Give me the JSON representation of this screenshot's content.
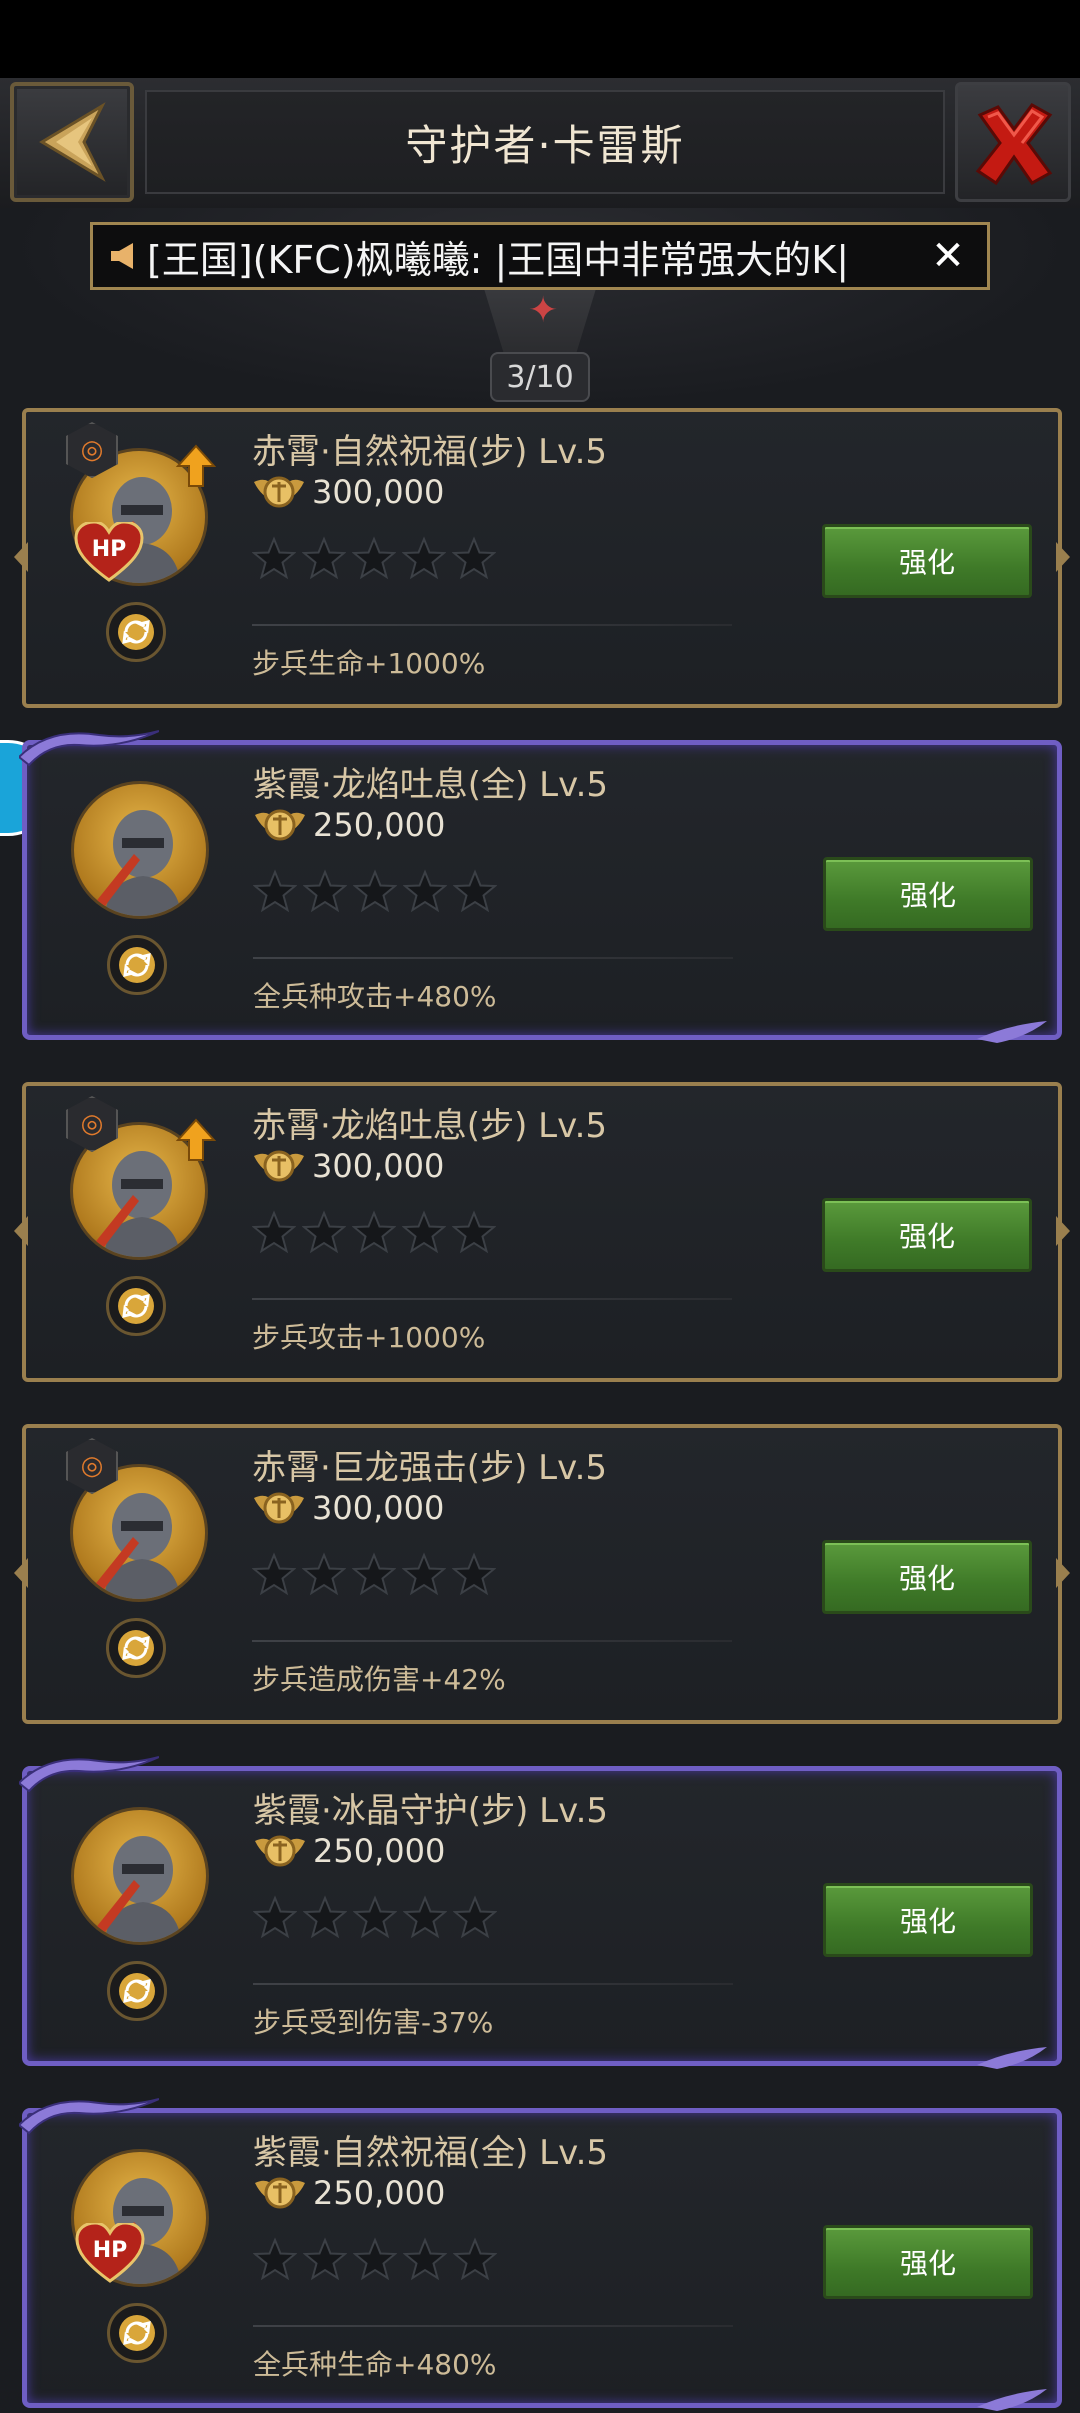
{
  "header": {
    "title": "守护者·卡雷斯"
  },
  "announcement": {
    "text": "[王国](KFC)枫曦曦: |王国中非常强大的K|",
    "close": "✕"
  },
  "progress": {
    "text": "3/10",
    "current": 3,
    "total": 10
  },
  "colors": {
    "gold_border": "#9a7f4e",
    "purple_border": "#6f5ec4",
    "button_green": "#4a8a32",
    "text_tan": "#d8c7a6"
  },
  "cards": [
    {
      "title": "赤霄·自然祝福(步) Lv.5",
      "cost": "300,000",
      "effect": "步兵生命+1000%",
      "button": "强化",
      "frame": "gold",
      "stars": 0
    },
    {
      "title": "紫霞·龙焰吐息(全) Lv.5",
      "cost": "250,000",
      "effect": "全兵种攻击+480%",
      "button": "强化",
      "frame": "purple",
      "stars": 0
    },
    {
      "title": "赤霄·龙焰吐息(步) Lv.5",
      "cost": "300,000",
      "effect": "步兵攻击+1000%",
      "button": "强化",
      "frame": "gold",
      "stars": 0
    },
    {
      "title": "赤霄·巨龙强击(步) Lv.5",
      "cost": "300,000",
      "effect": "步兵造成伤害+42%",
      "button": "强化",
      "frame": "gold",
      "stars": 0
    },
    {
      "title": "紫霞·冰晶守护(步) Lv.5",
      "cost": "250,000",
      "effect": "步兵受到伤害-37%",
      "button": "强化",
      "frame": "purple",
      "stars": 0
    },
    {
      "title": "紫霞·自然祝福(全) Lv.5",
      "cost": "250,000",
      "effect": "全兵种生命+480%",
      "button": "强化",
      "frame": "purple",
      "stars": 0
    }
  ]
}
